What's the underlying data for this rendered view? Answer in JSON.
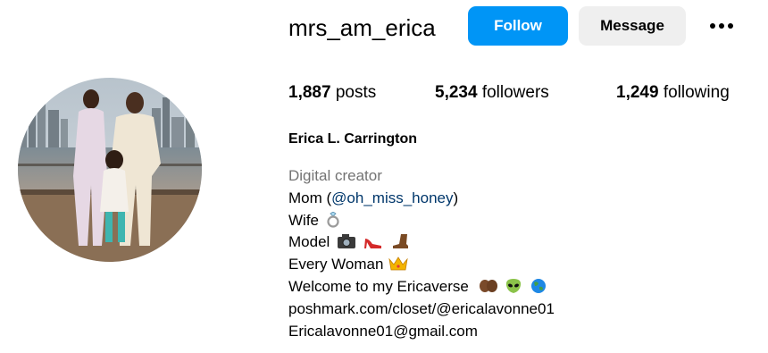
{
  "profile": {
    "username": "mrs_am_erica",
    "full_name": "Erica L. Carrington"
  },
  "actions": {
    "follow_label": "Follow",
    "message_label": "Message",
    "more_icon": "more-options-icon"
  },
  "stats": {
    "posts_count": "1,887",
    "posts_label": "posts",
    "followers_count": "5,234",
    "followers_label": "followers",
    "following_count": "1,249",
    "following_label": "following"
  },
  "bio": {
    "category": "Digital creator",
    "mom_prefix": "Mom (",
    "mom_mention": "@oh_miss_honey",
    "mom_suffix": ")",
    "wife": "Wife",
    "model": "Model",
    "every_woman": "Every Woman",
    "welcome": "Welcome to my Ericaverse",
    "link": "poshmark.com/closet/@ericalavonne01",
    "email": "Ericalavonne01@gmail.com"
  },
  "colors": {
    "follow_button": "#0095f6",
    "message_button": "#efefef",
    "category_text": "#737373",
    "mention_text": "#00376b"
  }
}
